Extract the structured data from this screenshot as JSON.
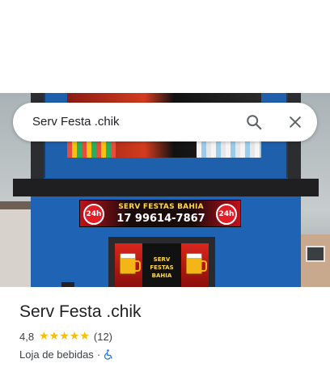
{
  "search": {
    "query": "Serv Festa .chik",
    "search_icon": "search-icon",
    "close_icon": "close-icon"
  },
  "photo": {
    "banner_left_badge": "24h",
    "banner_right_badge": "24h",
    "banner_title": "SERV FESTAS BAHIA",
    "banner_phone": "17 99614-7867",
    "door_text_line1": "SERV FESTAS",
    "door_text_line2": "BAHIA"
  },
  "place": {
    "name": "Serv Festa .chik",
    "rating": "4,8",
    "stars": 5,
    "review_count": "(12)",
    "category": "Loja de bebidas",
    "separator": "·",
    "accessibility_icon": "wheelchair-icon"
  },
  "colors": {
    "star": "#fbbc04",
    "accessibility_blue": "#1a73e8",
    "text_primary": "#202124",
    "text_secondary": "#3c4043"
  }
}
